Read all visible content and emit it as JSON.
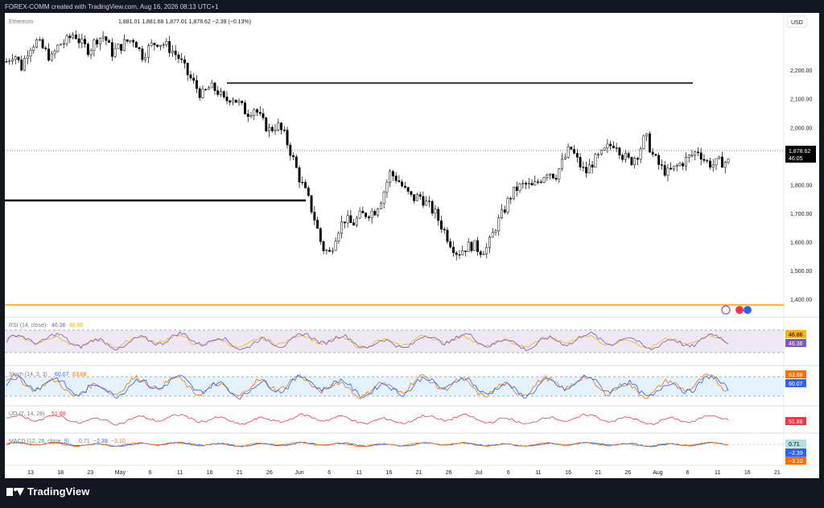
{
  "header": {
    "credit": "FOREX-COMM created with TradingView.com, Aug 16, 2026 08:13 UTC+1",
    "symbol": "Ethereum",
    "ohlc": "1,881.01  1,881.68  1,877.01  1,878.62  −2.39 (−0.13%)"
  },
  "currency_button": "USD",
  "price_axis": {
    "labels": [
      "2,200.00",
      "2,100.00",
      "2,000.00",
      "1,900.00",
      "1,800.00",
      "1,700.00",
      "1,600.00",
      "1,500.00",
      "1,400.00"
    ],
    "current_price": "1,878.62",
    "countdown": "46:05"
  },
  "time_axis": [
    "13",
    "18",
    "23",
    "May",
    "6",
    "11",
    "16",
    "21",
    "26",
    "Jun",
    "6",
    "11",
    "16",
    "21",
    "26",
    "Jul",
    "6",
    "11",
    "16",
    "21",
    "26",
    "Aug",
    "6",
    "11",
    "16",
    "21",
    "26"
  ],
  "indicators": {
    "rsi": {
      "label": "RSI (14, close)",
      "value": "46.36",
      "ma": "46.86",
      "color": "#7e57c2",
      "ma_color": "#f7b500"
    },
    "stoch": {
      "label": "Stoch (14, 3, 3)",
      "k": "60.07",
      "d": "63.68",
      "k_color": "#2962ff",
      "d_color": "#ff6d00"
    },
    "uo": {
      "label": "UO (7, 14, 28)",
      "value": "51.88",
      "color": "#f23645"
    },
    "macd": {
      "label": "MACD (12, 26, close, 9)",
      "hist": "0.71",
      "macd": "−2.39",
      "signal": "−3.10"
    }
  },
  "brand": "TradingView",
  "colors": {
    "up": "#000000",
    "support": "#f7a600",
    "axis_text": "#131722"
  },
  "chart_data": {
    "type": "candlestick",
    "title": "Ethereum",
    "ylabel": "USD",
    "ylim": [
      1340,
      2400
    ],
    "timeframe": "Apr 2026 – Aug 16, 2026",
    "close_path": [
      2230,
      2260,
      2210,
      2280,
      2300,
      2270,
      2240,
      2290,
      2300,
      2330,
      2290,
      2270,
      2310,
      2320,
      2260,
      2280,
      2300,
      2310,
      2250,
      2280,
      2300,
      2290,
      2270,
      2240,
      2190,
      2150,
      2110,
      2140,
      2130,
      2090,
      2110,
      2080,
      2050,
      2070,
      2020,
      1990,
      2010,
      1970,
      1900,
      1820,
      1760,
      1680,
      1580,
      1560,
      1640,
      1680,
      1660,
      1690,
      1700,
      1710,
      1760,
      1840,
      1820,
      1780,
      1750,
      1760,
      1730,
      1700,
      1650,
      1600,
      1560,
      1580,
      1590,
      1570,
      1580,
      1650,
      1700,
      1760,
      1790,
      1800,
      1790,
      1820,
      1850,
      1830,
      1880,
      1930,
      1880,
      1840,
      1880,
      1900,
      1930,
      1950,
      1900,
      1880,
      1910,
      1970,
      1900,
      1860,
      1840,
      1860,
      1880,
      1900,
      1920,
      1880,
      1870,
      1880,
      1878.62
    ],
    "horizontal_lines": [
      {
        "name": "resistance",
        "value": 2155
      },
      {
        "name": "mid-level",
        "value": 1745
      },
      {
        "name": "support",
        "value": 1380
      }
    ],
    "rsi_ylim": [
      20,
      85
    ],
    "rsi_levels": [
      70,
      30
    ]
  }
}
